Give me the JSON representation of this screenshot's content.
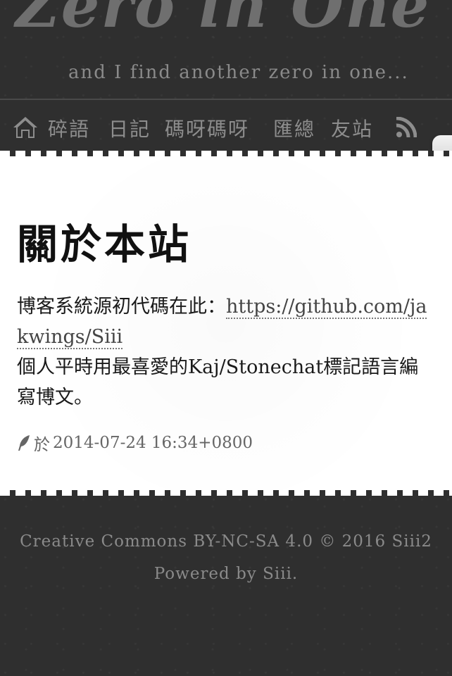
{
  "header": {
    "title": "Zero in One",
    "subtitle": "and I find another zero in one..."
  },
  "nav": {
    "home_icon": "home-icon",
    "items": [
      {
        "label": "碎語"
      },
      {
        "label": "日記"
      },
      {
        "label": "碼呀碼呀"
      },
      {
        "label": "匯總"
      },
      {
        "label": "友站"
      }
    ],
    "rss_icon": "rss-icon"
  },
  "article": {
    "title": "關於本站",
    "body_prefix": "博客系統源初代碼在此：",
    "link_text": "https://github.com/jakwings/Siii",
    "body_suffix": "個人平時用最喜愛的Kaj/Stonechat標記語言編寫博文。",
    "meta_prefix": "於",
    "timestamp": "2014-07-24 16:34+0800"
  },
  "footer": {
    "license": "Creative Commons BY-NC-SA 4.0 © 2016 Siii2",
    "powered": "Powered by Siii."
  },
  "colors": {
    "background": "#2f2f2f",
    "card": "#ffffff",
    "nav_text": "#8d8d8d"
  }
}
